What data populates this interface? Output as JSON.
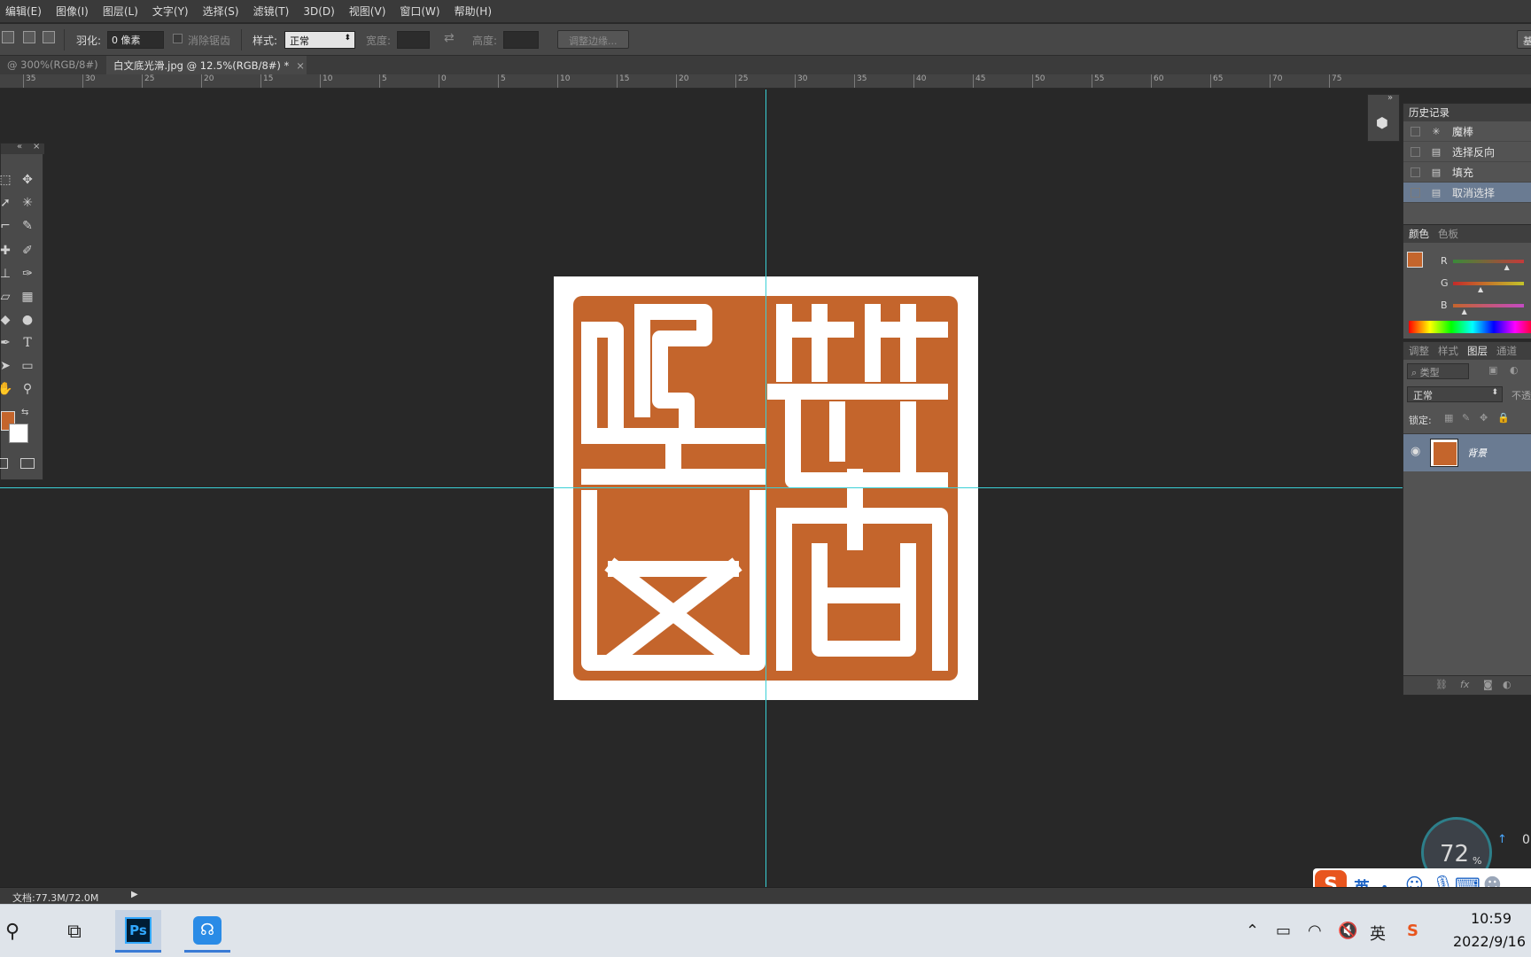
{
  "menu": [
    "编辑(E)",
    "图像(I)",
    "图层(L)",
    "文字(Y)",
    "选择(S)",
    "滤镜(T)",
    "3D(D)",
    "视图(V)",
    "窗口(W)",
    "帮助(H)"
  ],
  "options": {
    "feather_label": "羽化:",
    "feather_value": "0 像素",
    "antialias_label": "消除锯齿",
    "style_label": "样式:",
    "style_value": "正常",
    "width_label": "宽度:",
    "height_label": "高度:",
    "refine_button": "调整边缘...",
    "workspace_btn": "基"
  },
  "tabs": [
    {
      "label": "@ 300%(RGB/8#)",
      "close": "×"
    },
    {
      "label": "白文底光滑.jpg @ 12.5%(RGB/8#) *",
      "close": "×"
    }
  ],
  "ruler_ticks": [
    "35",
    "30",
    "25",
    "20",
    "15",
    "10",
    "5",
    "0",
    "5",
    "10",
    "15",
    "20",
    "25",
    "30",
    "35",
    "40",
    "45",
    "50",
    "55",
    "60",
    "65",
    "70",
    "75"
  ],
  "history": {
    "title": "历史记录",
    "items": [
      {
        "label": "魔棒",
        "icon": "magic-wand-icon",
        "selected": false
      },
      {
        "label": "选择反向",
        "icon": "history-state-icon",
        "selected": false
      },
      {
        "label": "填充",
        "icon": "history-state-icon",
        "selected": false
      },
      {
        "label": "取消选择",
        "icon": "history-state-icon",
        "selected": true
      }
    ]
  },
  "color_panel": {
    "tabs": [
      "颜色",
      "色板"
    ],
    "foreground": "#c4652c",
    "channels": [
      {
        "label": "R",
        "fraction": 0.77
      },
      {
        "label": "G",
        "fraction": 0.4
      },
      {
        "label": "B",
        "fraction": 0.17
      }
    ]
  },
  "layers_panel": {
    "tabs": [
      "调整",
      "样式",
      "图层",
      "通道"
    ],
    "filter_label": "类型",
    "blend_mode": "正常",
    "opacity_label": "不透",
    "lock_label": "锁定:",
    "layers": [
      {
        "name": "背景",
        "visible": true
      }
    ]
  },
  "status": {
    "doc_size": "文档:77.3M/72.0M"
  },
  "widget": {
    "percent": "72",
    "percent_sign": "%",
    "value": "0"
  },
  "ime_bar": {
    "lang": "英",
    "punct": "•，"
  },
  "taskbar": {
    "tray_lang": "英",
    "time": "10:59",
    "date": "2022/9/16"
  },
  "colors": {
    "seal": "#c4652c",
    "guide": "#3ad0d6",
    "history_selected": "#6a7b92"
  }
}
